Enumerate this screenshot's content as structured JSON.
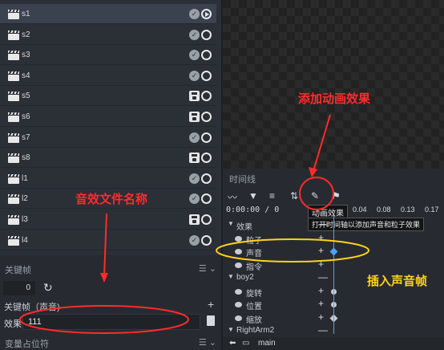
{
  "scenes": [
    {
      "name": "s1",
      "status": "check",
      "selected": true
    },
    {
      "name": "s2",
      "status": "check"
    },
    {
      "name": "s3",
      "status": "check"
    },
    {
      "name": "s4",
      "status": "check"
    },
    {
      "name": "s5",
      "status": "disk"
    },
    {
      "name": "s6",
      "status": "disk"
    },
    {
      "name": "s7",
      "status": "check"
    },
    {
      "name": "s8",
      "status": "disk"
    },
    {
      "name": "l1",
      "status": "check"
    },
    {
      "name": "l2",
      "status": "check"
    },
    {
      "name": "l3",
      "status": "disk"
    },
    {
      "name": "l4",
      "status": "check"
    }
  ],
  "keyframe_panel": {
    "title": "关键帧",
    "frame_value": "0",
    "sound_label": "关键帧（声音)",
    "effect_label": "效果",
    "effect_value": "111",
    "var_label": "变量占位符"
  },
  "timeline": {
    "title": "时间线",
    "time": "0:00:00",
    "slash": "/",
    "total": "0",
    "ticks": [
      "0.04",
      "0.08",
      "0.13",
      "0.17"
    ],
    "tooltip_title": "动画效果",
    "tooltip_desc": "打开时间轴以添加声音和粒子效果",
    "tracks": [
      {
        "name": "效果",
        "level": 0
      },
      {
        "name": "粒子",
        "level": 1
      },
      {
        "name": "声音",
        "level": 1
      },
      {
        "name": "指令",
        "level": 1
      },
      {
        "name": "boy2",
        "level": 0
      },
      {
        "name": "旋转",
        "level": 1
      },
      {
        "name": "位置",
        "level": 1
      },
      {
        "name": "缩放",
        "level": 1
      },
      {
        "name": "RightArm2",
        "level": 0
      }
    ],
    "footer_tab": "main"
  },
  "annotations": {
    "add_effect": "添加动画效果",
    "sound_name": "音效文件名称",
    "insert_sound": "插入声音帧"
  },
  "colors": {
    "accent": "#4aa3ff",
    "annotation_red": "#ff2b2b",
    "annotation_yellow": "#ffd21a"
  }
}
